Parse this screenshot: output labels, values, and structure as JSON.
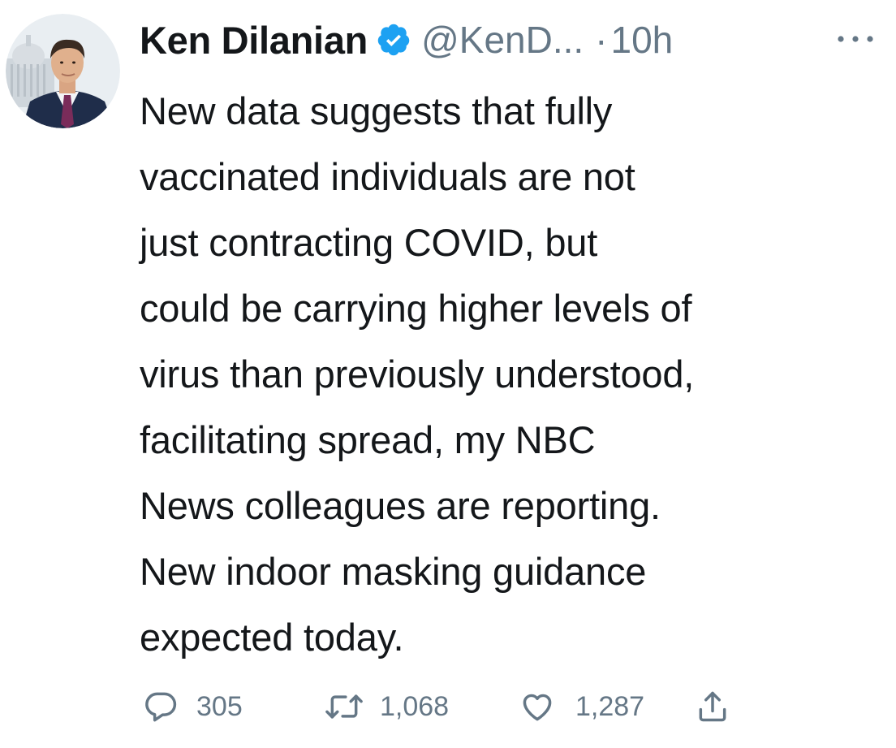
{
  "tweet": {
    "author": {
      "display_name": "Ken Dilanian",
      "handle": "@KenD...",
      "verified": true
    },
    "separator": "·",
    "timestamp": "10h",
    "text_lines": [
      "New data suggests that fully",
      "vaccinated individuals are not",
      "just contracting COVID, but",
      "could be carrying higher levels of",
      "virus than previously understood,",
      "facilitating spread, my NBC",
      "News colleagues are reporting.",
      "New indoor masking guidance",
      "expected today."
    ],
    "actions": {
      "reply_count": "305",
      "retweet_count": "1,068",
      "like_count": "1,287"
    }
  },
  "icons": {
    "avatar": "avatar-photo",
    "verified": "verified-badge-icon",
    "more": "more-options-icon",
    "reply": "reply-icon",
    "retweet": "retweet-icon",
    "like": "heart-icon",
    "share": "share-icon"
  },
  "colors": {
    "text_primary": "#14171a",
    "text_secondary": "#657786",
    "verified_blue": "#1da1f2",
    "background": "#ffffff"
  }
}
